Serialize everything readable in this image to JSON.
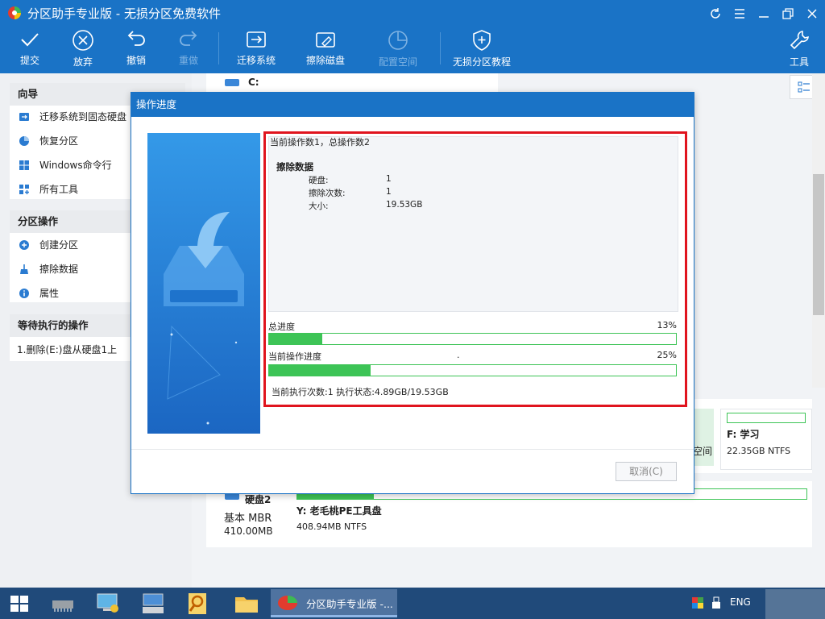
{
  "window": {
    "title": "分区助手专业版 - 无损分区免费软件"
  },
  "toolbar": {
    "submit": "提交",
    "discard": "放弃",
    "undo": "撤销",
    "redo": "重做",
    "migrate": "迁移系统",
    "wipe_disk": "擦除磁盘",
    "config_space": "配置空间",
    "tutorial": "无损分区教程",
    "tools": "工具"
  },
  "sidebar": {
    "wizard_title": "向导",
    "wizard_items": [
      "迁移系统到固态硬盘",
      "恢复分区",
      "Windows命令行",
      "所有工具"
    ],
    "partition_title": "分区操作",
    "partition_items": [
      "创建分区",
      "擦除数据",
      "属性"
    ],
    "pending_title": "等待执行的操作",
    "pending_items": [
      "1.删除(E:)盘从硬盘1上"
    ]
  },
  "main": {
    "drive_c": "C:",
    "partition_f_name": "F: 学习",
    "partition_f_size": "22.35GB NTFS",
    "unallocated_label": "空间",
    "disk2_name": "硬盘2",
    "disk2_type": "基本 MBR",
    "disk2_size": "410.00MB",
    "partition_y_name": "Y: 老毛桃PE工具盘",
    "partition_y_size": "408.94MB NTFS",
    "partition_y_usage": 0.15
  },
  "dialog": {
    "title": "操作进度",
    "op_count": "当前操作数1，总操作数2",
    "op_name": "擦除数据",
    "details": [
      {
        "key": "硬盘:",
        "value": "1"
      },
      {
        "key": "擦除次数:",
        "value": "1"
      },
      {
        "key": "大小:",
        "value": "19.53GB"
      }
    ],
    "total_label": "总进度",
    "total_percent": "13%",
    "total_value": 0.13,
    "current_label": "当前操作进度",
    "current_dot": ".",
    "current_percent": "25%",
    "current_value": 0.25,
    "status": "当前执行次数:1 执行状态:4.89GB/19.53GB",
    "cancel": "取消(C)",
    "highlight_color": "#e0141e",
    "progress_color": "#3dc456"
  },
  "taskbar": {
    "active_app": "分区助手专业版 -...",
    "lang": "ENG"
  },
  "colors": {
    "accent": "#1a73c6"
  }
}
